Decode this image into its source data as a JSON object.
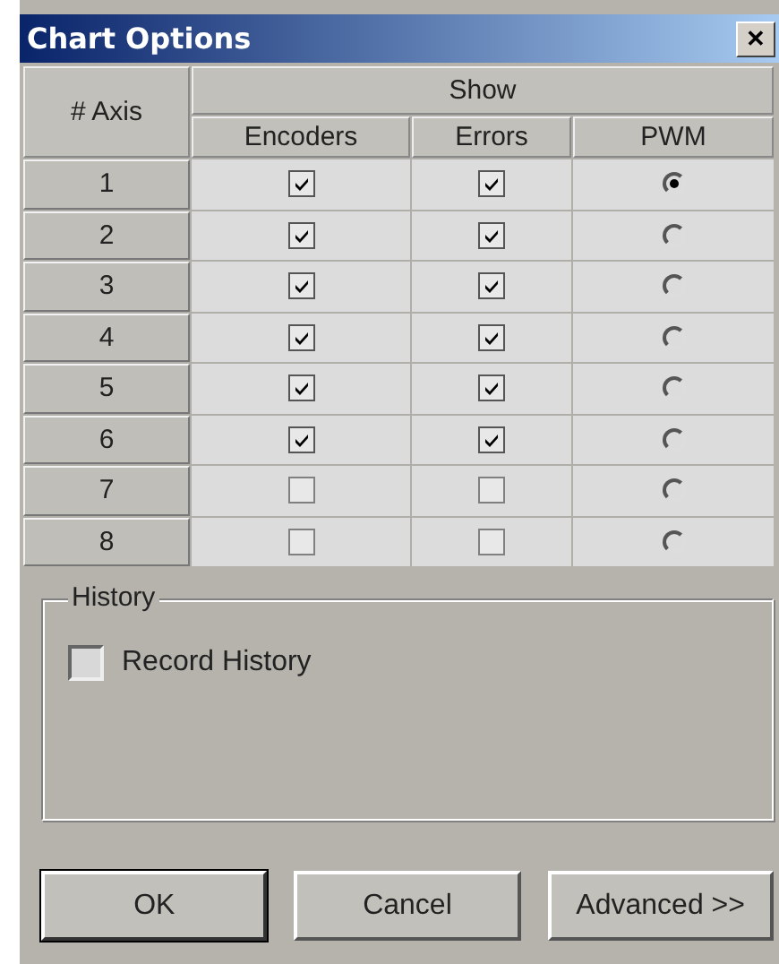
{
  "window": {
    "title": "Chart Options",
    "close": "✕"
  },
  "table": {
    "axis_heading": "# Axis",
    "group_heading": "Show",
    "columns": [
      "Encoders",
      "Errors",
      "PWM"
    ],
    "rows": [
      {
        "axis": "1",
        "encoders": true,
        "errors": true,
        "pwm_selected": true
      },
      {
        "axis": "2",
        "encoders": true,
        "errors": true,
        "pwm_selected": false
      },
      {
        "axis": "3",
        "encoders": true,
        "errors": true,
        "pwm_selected": false
      },
      {
        "axis": "4",
        "encoders": true,
        "errors": true,
        "pwm_selected": false
      },
      {
        "axis": "5",
        "encoders": true,
        "errors": true,
        "pwm_selected": false
      },
      {
        "axis": "6",
        "encoders": true,
        "errors": true,
        "pwm_selected": false
      },
      {
        "axis": "7",
        "encoders": false,
        "errors": false,
        "pwm_selected": false
      },
      {
        "axis": "8",
        "encoders": false,
        "errors": false,
        "pwm_selected": false
      }
    ]
  },
  "history": {
    "title": "History",
    "record": {
      "label": "Record History",
      "checked": false
    }
  },
  "buttons": [
    {
      "label": "OK",
      "default": true
    },
    {
      "label": "Cancel",
      "default": false
    },
    {
      "label": "Advanced >>",
      "default": false
    }
  ]
}
